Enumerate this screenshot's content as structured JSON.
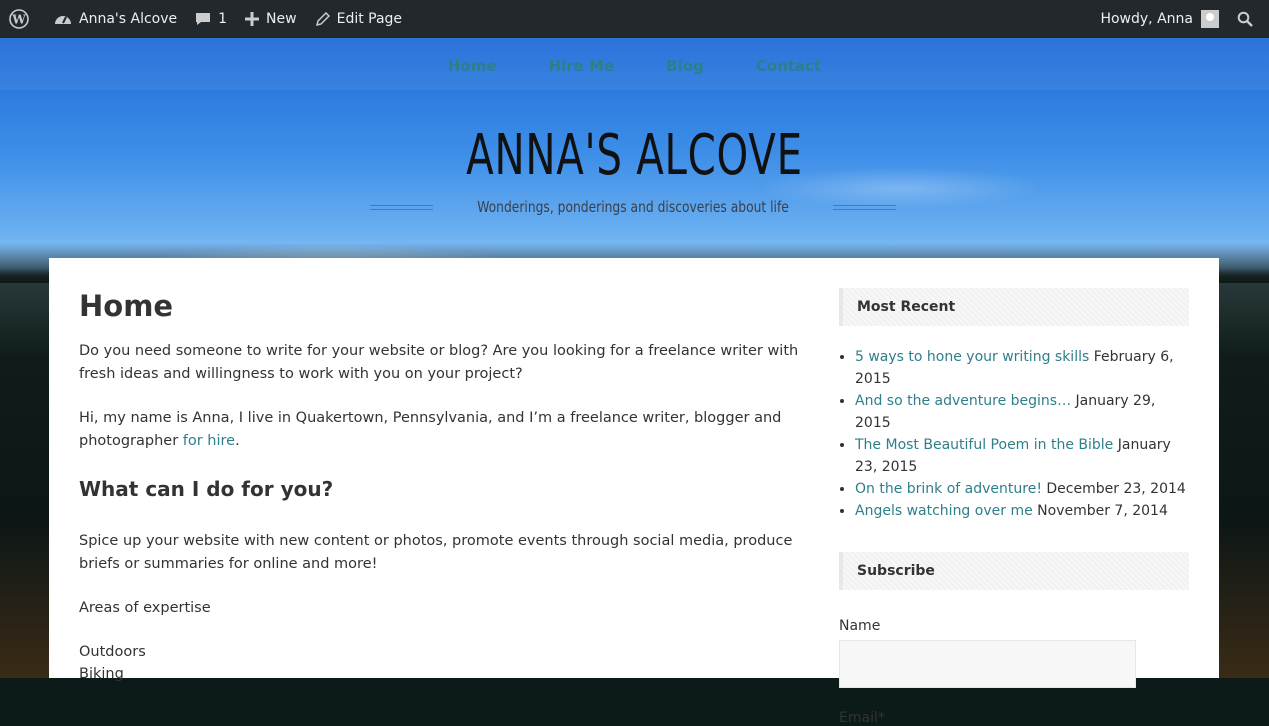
{
  "adminbar": {
    "site_name": "Anna's Alcove",
    "comments_count": "1",
    "new_label": "New",
    "edit_label": "Edit Page",
    "greeting": "Howdy, Anna"
  },
  "nav": {
    "items": [
      "Home",
      "Hire Me",
      "Blog",
      "Contact"
    ]
  },
  "header": {
    "title": "ANNA'S ALCOVE",
    "tagline": "Wonderings, ponderings and discoveries about life"
  },
  "main": {
    "title": "Home",
    "p1": "Do you need someone to write for your website or blog? Are you looking for a freelance writer with fresh ideas and willingness to work with you on your project?",
    "p2_text": "Hi, my name is Anna, I live in Quakertown, Pennsylvania, and I’m a freelance writer, blogger and photographer ",
    "p2_link": "for hire",
    "p2_end": ".",
    "h2": "What can I do for you?",
    "p3": "Spice up your website with new content or photos, promote events through social media, produce briefs or summaries for online and more!",
    "p4": "Areas of expertise",
    "list": [
      "Outdoors",
      "Biking"
    ]
  },
  "sidebar": {
    "recent_title": "Most Recent",
    "recent": [
      {
        "title": "5 ways to hone your writing skills",
        "date": " February 6, 2015"
      },
      {
        "title": "And so the adventure begins…",
        "date": " January 29, 2015"
      },
      {
        "title": "The Most Beautiful Poem in the Bible",
        "date": " January 23, 2015"
      },
      {
        "title": "On the brink of adventure!",
        "date": " December 23, 2014"
      },
      {
        "title": "Angels watching over me",
        "date": " November 7, 2014"
      }
    ],
    "subscribe_title": "Subscribe",
    "name_label": "Name",
    "name_value": "",
    "email_label": "Email*"
  },
  "colors": {
    "link": "#2e7f8a",
    "adminbar": "#23282d"
  }
}
